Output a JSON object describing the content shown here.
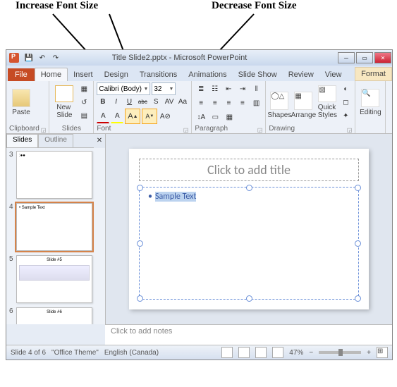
{
  "callouts": {
    "increase": "Increase Font Size",
    "decrease": "Decrease Font Size"
  },
  "window": {
    "title": "Title Slide2.pptx - Microsoft PowerPoint"
  },
  "tabs": {
    "file": "File",
    "items": [
      "Home",
      "Insert",
      "Design",
      "Transitions",
      "Animations",
      "Slide Show",
      "Review",
      "View"
    ],
    "contextual": "Format",
    "active": "Home"
  },
  "ribbon": {
    "clipboard": {
      "label": "Clipboard",
      "paste": "Paste"
    },
    "slides": {
      "label": "Slides",
      "newSlide": "New\nSlide"
    },
    "font": {
      "label": "Font",
      "fontName": "Calibri (Body)",
      "fontSize": "32",
      "bold": "B",
      "italic": "I",
      "underline": "U",
      "strike": "abc",
      "shadow": "S",
      "spacing": "AV",
      "case": "Aa",
      "clear": "A",
      "grow": "A▲",
      "shrink": "A▼"
    },
    "paragraph": {
      "label": "Paragraph"
    },
    "drawing": {
      "label": "Drawing",
      "shapes": "Shapes",
      "arrange": "Arrange",
      "quick": "Quick\nStyles"
    },
    "editing": {
      "label": "Editing",
      "editing": "Editing"
    }
  },
  "thumbPane": {
    "tabs": {
      "slides": "Slides",
      "outline": "Outline"
    },
    "thumbs": [
      {
        "num": "3",
        "preview": ":●●"
      },
      {
        "num": "4",
        "preview": "• Sample Text",
        "selected": true
      },
      {
        "num": "5",
        "preview": "Slide #5"
      },
      {
        "num": "6",
        "preview": "Slide #6"
      }
    ]
  },
  "slide": {
    "titlePlaceholder": "Click to add title",
    "bodyText": "Sample Text"
  },
  "notes": {
    "placeholder": "Click to add notes"
  },
  "status": {
    "slideInfo": "Slide 4 of 6",
    "theme": "\"Office Theme\"",
    "language": "English (Canada)",
    "zoom": "47%"
  }
}
